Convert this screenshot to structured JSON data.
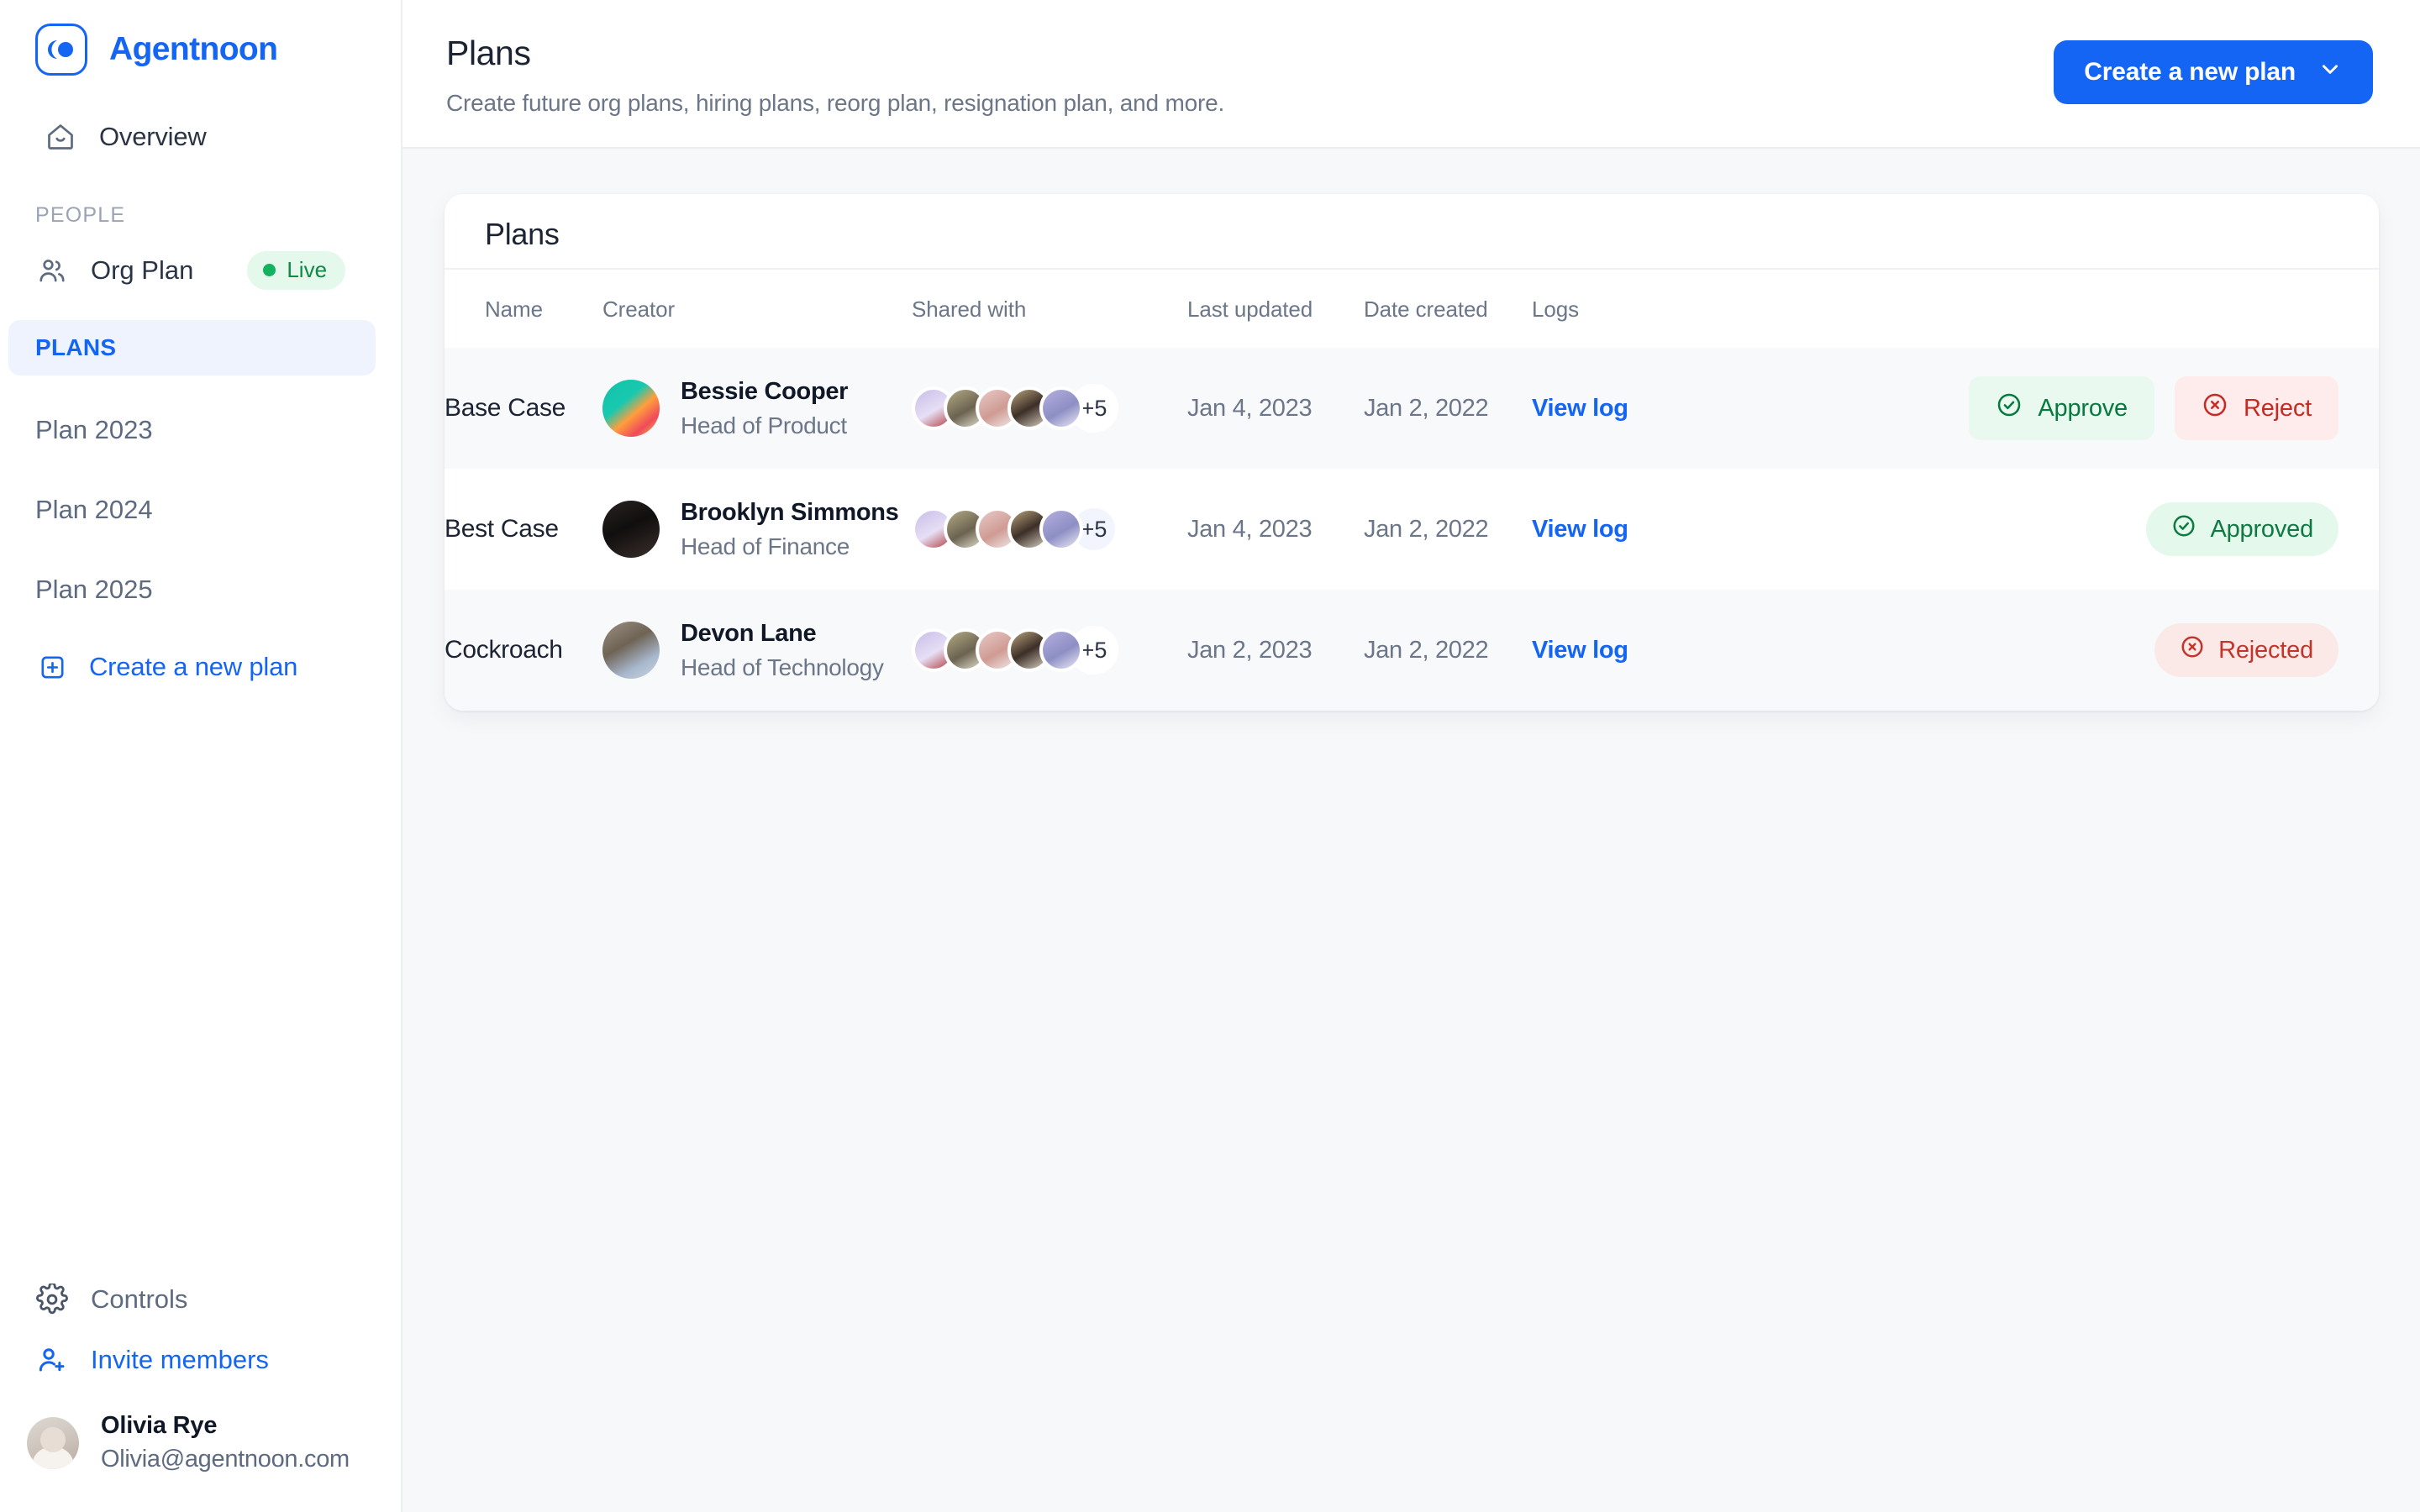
{
  "brand": {
    "name": "Agentnoon",
    "logo_icon": "agentnoon-logo-icon",
    "accent": "#1565f5"
  },
  "sidebar": {
    "overview": {
      "label": "Overview",
      "icon": "home-icon"
    },
    "section_people": "PEOPLE",
    "org_plan": {
      "label": "Org Plan",
      "icon": "users-icon",
      "badge": "Live",
      "badge_color": "#12b25e"
    },
    "plans_header": "PLANS",
    "plan_links": [
      {
        "label": "Plan 2023"
      },
      {
        "label": "Plan 2024"
      },
      {
        "label": "Plan 2025"
      }
    ],
    "create_plan": {
      "label": "Create a new plan",
      "icon": "plus-square-icon"
    },
    "controls": {
      "label": "Controls",
      "icon": "gear-icon"
    },
    "invite": {
      "label": "Invite members",
      "icon": "user-plus-icon"
    },
    "profile": {
      "name": "Olivia Rye",
      "email": "Olivia@agentnoon.com",
      "avatar": "user-avatar"
    }
  },
  "header": {
    "title": "Plans",
    "subtitle": "Create future org plans, hiring plans, reorg plan, resignation plan, and more.",
    "create_button": {
      "label": "Create a new plan",
      "icon": "chevron-down-icon"
    }
  },
  "card": {
    "title": "Plans",
    "columns": [
      "Name",
      "Creator",
      "Shared with",
      "Last updated",
      "Date created",
      "Logs",
      ""
    ],
    "shared_overflow": "+5",
    "log_link_label": "View log",
    "rows": [
      {
        "name": "Base Case",
        "creator": {
          "name": "Bessie Cooper",
          "role": "Head of Product"
        },
        "shared_with": "+5",
        "last_updated": "Jan 4, 2023",
        "date_created": "Jan 2, 2022",
        "logs": "View log",
        "status": "pending",
        "approve_label": "Approve",
        "reject_label": "Reject"
      },
      {
        "name": "Best Case",
        "creator": {
          "name": "Brooklyn Simmons",
          "role": "Head of Finance"
        },
        "shared_with": "+5",
        "last_updated": "Jan 4, 2023",
        "date_created": "Jan 2, 2022",
        "logs": "View log",
        "status": "approved",
        "status_label": "Approved"
      },
      {
        "name": "Cockroach",
        "creator": {
          "name": "Devon Lane",
          "role": "Head of Technology"
        },
        "shared_with": "+5",
        "last_updated": "Jan 2, 2023",
        "date_created": "Jan 2, 2022",
        "logs": "View log",
        "status": "rejected",
        "status_label": "Rejected"
      }
    ]
  }
}
